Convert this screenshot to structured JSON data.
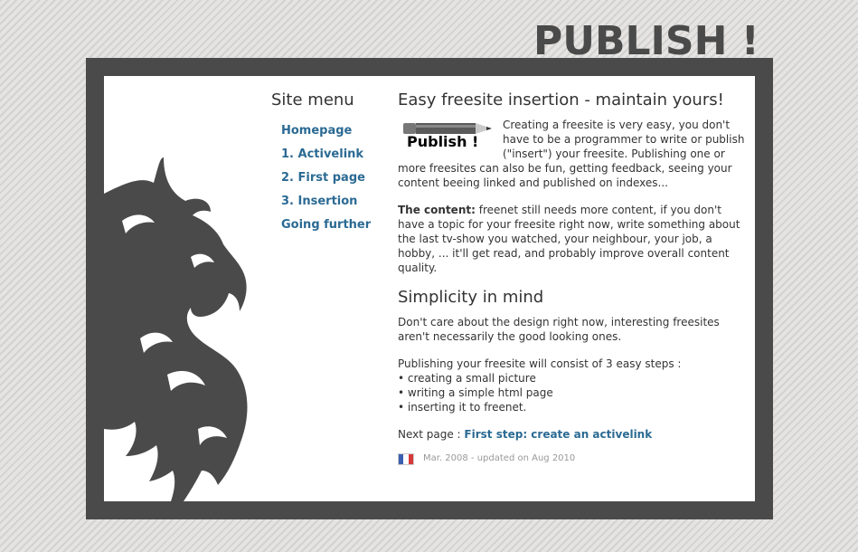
{
  "site": {
    "title": "PUBLISH !"
  },
  "menu": {
    "heading": "Site menu",
    "items": [
      {
        "label": "Homepage"
      },
      {
        "label": "1. Activelink"
      },
      {
        "label": "2. First page"
      },
      {
        "label": "3. Insertion"
      },
      {
        "label": "Going further"
      }
    ]
  },
  "content": {
    "heading": "Easy freesite insertion - maintain yours!",
    "logo_text": "Publish !",
    "intro": "Creating a freesite is very easy, you don't have to be a programmer to write or publish (\"insert\") your freesite. Publishing one or more freesites can also be fun, getting feedback, seeing your content beeing linked and published on indexes...",
    "content_label": "The content:",
    "content_text": " freenet still needs more content, if you don't have a topic for your freesite right now, write something about the last tv-show you watched, your neighbour, your job, a hobby, ... it'll get read, and probably improve overall content quality.",
    "subheading": "Simplicity in mind",
    "simplicity_text": "Don't care about the design right now, interesting freesites aren't necessarily the good looking ones.",
    "steps_intro": "Publishing your freesite will consist of 3 easy steps :",
    "steps": [
      "• creating a small picture",
      "• writing a simple html page",
      "• inserting it to freenet."
    ],
    "next_label": "Next page : ",
    "next_link": "First step: create an activelink",
    "footer_date": "Mar. 2008 - updated on Aug 2010"
  },
  "colors": {
    "frame": "#4a4a4a",
    "link": "#2b6a93",
    "background": "#dcdcdc"
  },
  "icons": {
    "logo": "pencil-icon",
    "language": "french-flag-icon",
    "decoration": "dragon-icon"
  }
}
